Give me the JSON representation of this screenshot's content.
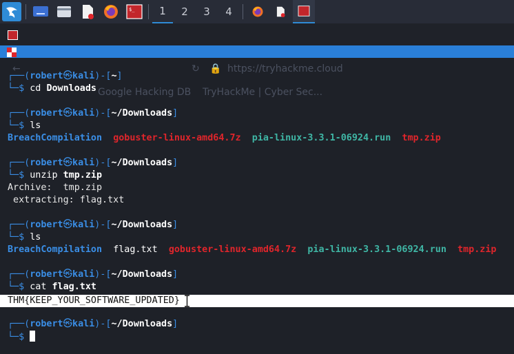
{
  "panel": {
    "workspaces": [
      "1",
      "2",
      "3",
      "4"
    ],
    "active_workspace": "1",
    "launcher_icons": [
      "kali-menu-icon",
      "desktop-icon",
      "file-manager-icon",
      "text-editor-icon",
      "firefox-icon",
      "terminal-icon"
    ],
    "task_icons": [
      "firefox-icon",
      "text-editor-icon",
      "terminal-icon"
    ]
  },
  "ghost_browser": {
    "url": "https://tryhackme.cloud",
    "url_host": "tryhackme.cloud",
    "bookmark1": "Google Hacking DB",
    "bookmark2": "TryHackMe | Cyber Sec..."
  },
  "terminal": {
    "user": "robert",
    "host": "kali",
    "prompt_open": "┌──(",
    "prompt_at": "㉿",
    "prompt_mid": ")-[",
    "prompt_close": "]",
    "prompt_dollar": "└─$ ",
    "home_dir": "~",
    "dl_dir": "~/Downloads",
    "cmd1": "cd",
    "cmd1_arg": "Downloads",
    "cmd2": "ls",
    "ls1": [
      "BreachCompilation",
      "gobuster-linux-amd64.7z",
      "pia-linux-3.3.1-06924.run",
      "tmp.zip"
    ],
    "cmd3": "unzip",
    "cmd3_arg": "tmp.zip",
    "unzip_out1": "Archive:  tmp.zip",
    "unzip_out2": " extracting: flag.txt",
    "cmd4": "ls",
    "ls2": [
      "BreachCompilation",
      "flag.txt",
      "gobuster-linux-amd64.7z",
      "pia-linux-3.3.1-06924.run",
      "tmp.zip"
    ],
    "cmd5": "cat",
    "cmd5_arg": "flag.txt",
    "flag": "THM{KEEP_YOUR_SOFTWARE_UPDATED}"
  },
  "colors": {
    "panel_bg": "#282c37",
    "accent": "#2f8bd6",
    "prompt_blue": "#3a8ee6",
    "archive_red": "#e0252b",
    "exec_green": "#3fb6a5"
  }
}
